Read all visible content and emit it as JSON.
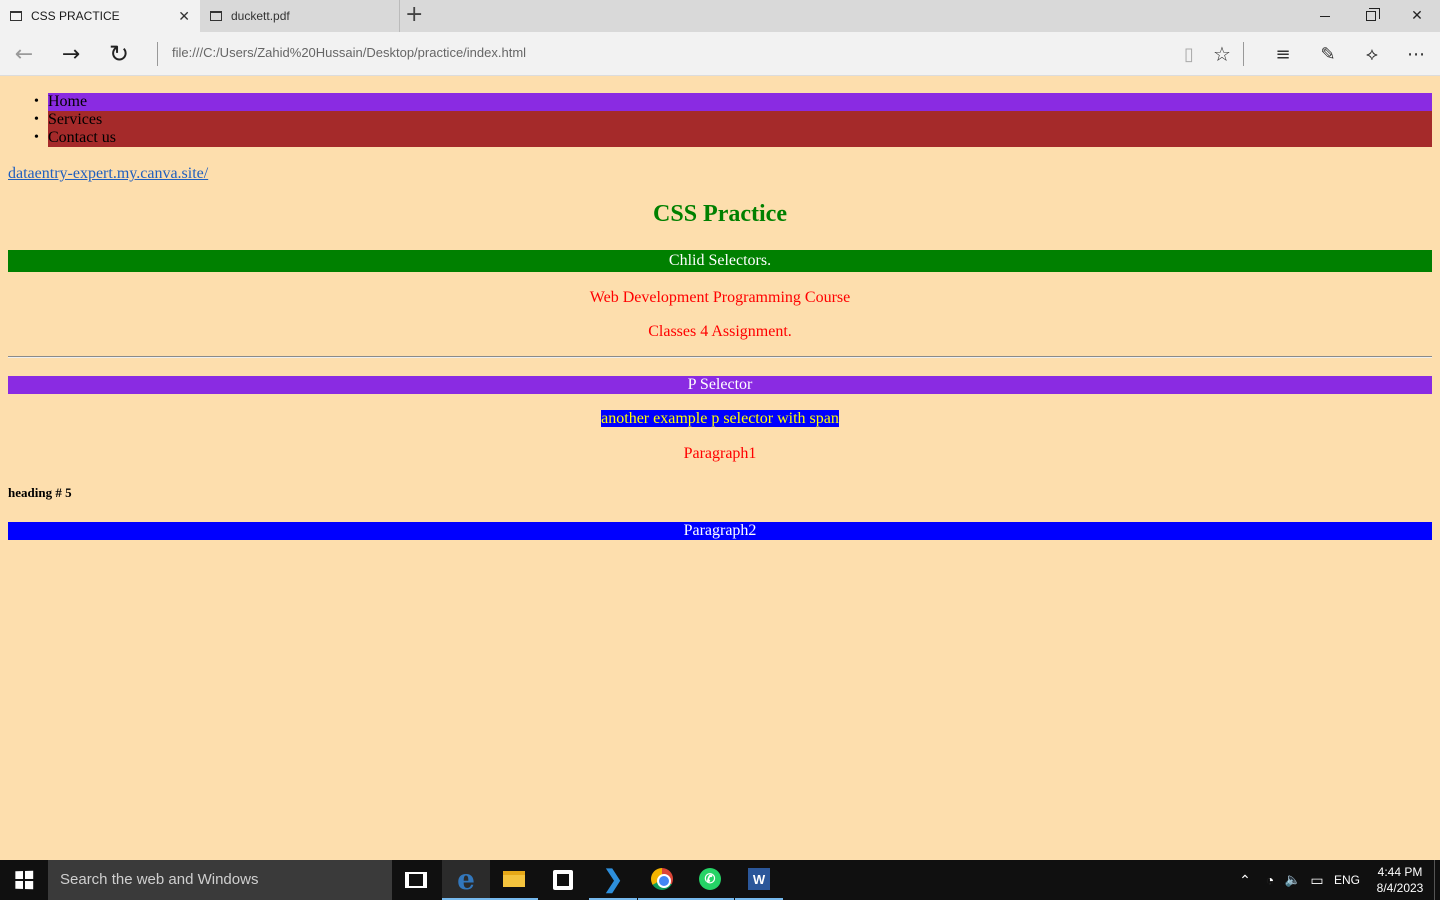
{
  "browser": {
    "tabs": [
      {
        "title": "CSS PRACTICE",
        "active": true
      },
      {
        "title": "duckett.pdf",
        "active": false
      }
    ],
    "new_tab_icon": "plus-icon",
    "address": "file:///C:/Users/Zahid%20Hussain/Desktop/practice/index.html",
    "window_controls": [
      "minimize-icon",
      "restore-icon",
      "close-icon"
    ],
    "toolbar_icons": [
      "reading-view-icon",
      "favorite-star-icon",
      "hub-icon",
      "web-note-icon",
      "share-icon",
      "more-icon"
    ]
  },
  "page": {
    "menu": [
      {
        "label": "Home",
        "bg": "#8a2be2"
      },
      {
        "label": "Services",
        "bg": "#a52a2a"
      },
      {
        "label": "Contact us",
        "bg": "#a52a2a"
      }
    ],
    "link": "dataentry-expert.my.canva.site/",
    "title": "CSS Practice",
    "child_selectors_heading": "Chlid Selectors.",
    "course_line": "Web Development Programming Course",
    "assignment_line": "Classes 4 Assignment.",
    "p_selector_heading": "P Selector",
    "span_example": "another example p selector with span",
    "paragraph1": "Paragraph1",
    "heading5": "heading # 5",
    "paragraph2": "Paragraph2",
    "colors": {
      "background": "#fddead",
      "green": "#008000",
      "purple": "#8a2be2",
      "brown": "#a52a2a",
      "blue": "#0000ff",
      "red": "#ff0000",
      "yellow": "#ffff00"
    }
  },
  "taskbar": {
    "search_placeholder": "Search the web and Windows",
    "apps": [
      "task-view-icon",
      "edge-icon",
      "file-explorer-icon",
      "store-icon",
      "vscode-icon",
      "chrome-icon",
      "whatsapp-icon",
      "word-icon"
    ],
    "tray": {
      "language": "ENG",
      "time": "4:44 PM",
      "date": "8/4/2023"
    }
  }
}
